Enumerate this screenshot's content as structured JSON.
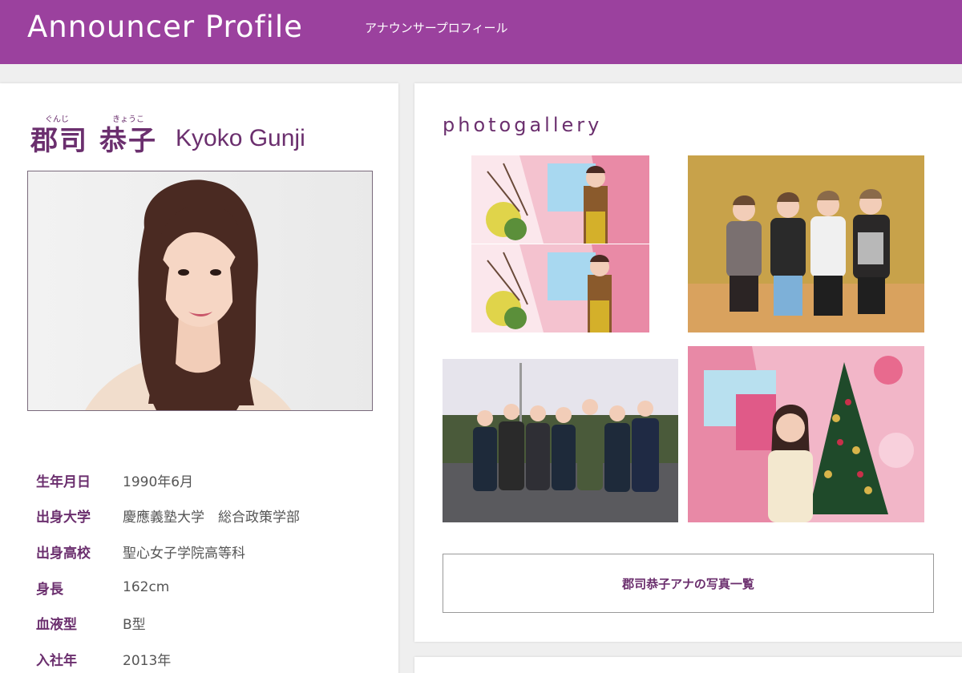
{
  "header": {
    "title": "Announcer Profile",
    "subtitle": "アナウンサープロフィール",
    "background_color": "#9b419e"
  },
  "profile": {
    "ruby_family": "ぐんじ",
    "ruby_given": "きょうこ",
    "name_family": "郡司",
    "name_given": "恭子",
    "name_en": "Kyoko Gunji",
    "accent_color": "#6b2f6e",
    "info": [
      {
        "label": "生年月日",
        "value": "1990年6月"
      },
      {
        "label": "出身大学",
        "value": "慶應義塾大学　総合政策学部"
      },
      {
        "label": "出身高校",
        "value": "聖心女子学院高等科"
      },
      {
        "label": "身長",
        "value": "162cm"
      },
      {
        "label": "血液型",
        "value": "B型"
      },
      {
        "label": "入社年",
        "value": "2013年"
      }
    ]
  },
  "gallery": {
    "title": "photogallery",
    "button_label": "郡司恭子アナの写真一覧",
    "photos": [
      "studio-pink-set-two-poses",
      "four-women-gold-backdrop",
      "group-outdoor-winter",
      "christmas-tree-studio"
    ]
  }
}
